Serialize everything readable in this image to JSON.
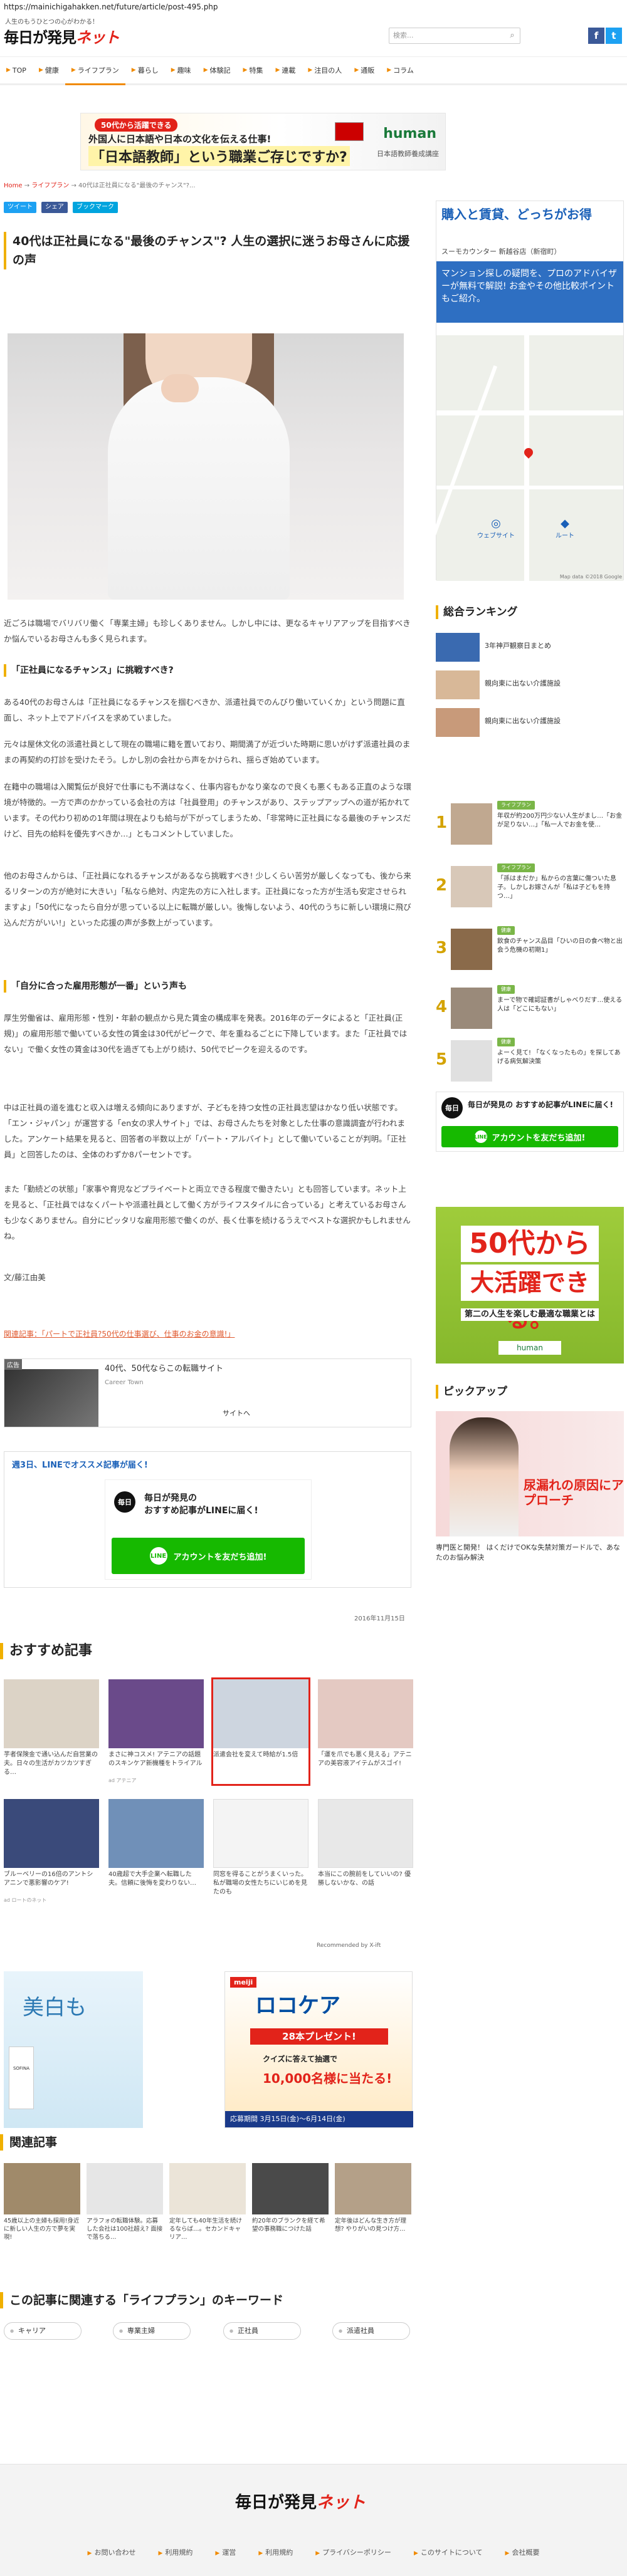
{
  "browser": {
    "url": "https://mainichigahakken.net/future/article/post-495.php"
  },
  "header": {
    "tagline": "人生のもうひとつの心がわかる！",
    "logo_main": "毎日が発見",
    "logo_net": "ネット",
    "search_placeholder": "検索...",
    "search_icon": "search-icon",
    "social": [
      {
        "label": "f",
        "color": "#3b5998"
      },
      {
        "label": "t",
        "color": "#1da1f2"
      },
      {
        "label": "L",
        "color": "#1a60b8"
      }
    ]
  },
  "nav": {
    "items": [
      "TOP",
      "健康",
      "ライフプラン",
      "暮らし",
      "趣味",
      "体験記",
      "特集",
      "連載",
      "注目の人",
      "通販",
      "コラム"
    ],
    "active_index": 2,
    "accent": "#f08a00"
  },
  "top_ad": {
    "badge": "50代から活躍できる",
    "line1": "外国人に日本語や日本の文化を伝える仕事!",
    "line2": "「日本語教師」という職業ご存じですか?",
    "brand": "human",
    "brand_sub": "日本語教師養成講座"
  },
  "breadcrumb": {
    "home": "Home",
    "sep": " → ",
    "cat": "ライフプラン",
    "current": "40代は正社員になる\"最後のチャンス\"?..."
  },
  "share": [
    {
      "label": "ツイート",
      "color": "#1da1f2"
    },
    {
      "label": "シェア",
      "color": "#3b5998"
    },
    {
      "label": "ブックマーク",
      "color": "#00a4de"
    }
  ],
  "article": {
    "title": "40代は正社員になる\"最後のチャンス\"? 人生の選択に迷うお母さんに応援の声",
    "intro": "近ごろは職場でバリバリ働く「専業主婦」も珍しくありません。しかし中には、更なるキャリアアップを目指すべきか悩んでいるお母さんも多く見られます。",
    "sec1": "「正社員になるチャンス」に挑戦すべき?",
    "p1": "ある40代のお母さんは「正社員になるチャンスを掴むべきか、派遣社員でのんびり働いていくか」という問題に直面し、ネット上でアドバイスを求めていました。",
    "p2": "元々は屋休文化の派遣社員として現在の職場に籍を置いており、期間満了が近づいた時期に思いがけず派遣社員のままの再契約の打診を受けたそう。しかし別の会社から声をかけられ、揺らぎ始めています。",
    "p3": "在籍中の職場は入閣覧伝が良好で仕事にも不満はなく、仕事内容もかなり楽なので良くも悪くもある正直のような環境が特徴的。一方で声のかかっている会社の方は「社員登用」のチャンスがあり、ステップアップへの道が拓かれています。その代わり初めの1年間は現在よりも給与が下がってしまうため、「非常時に正社員になる最後のチャンスだけど、目先の給料を優先すべきか…」ともコメントしていました。",
    "p4": "他のお母さんからは、「正社員になれるチャンスがあるなら挑戦すべき! 少しくらい苦労が厳しくなっても、後から来るリターンの方が絶対に大きい」「私なら絶対、内定先の方に入社します。正社員になった方が生活も安定させられますよ」「50代になったら自分が思っている以上に転職が厳しい。後悔しないよう、40代のうちに新しい環境に飛び込んだ方がいい!」といった応援の声が多数上がっています。",
    "sec2": "「自分に合った雇用形態が一番」という声も",
    "p5": "厚生労働省は、雇用形態・性別・年齢の観点から見た賃金の構成率を発表。2016年のデータによると「正社員(正規)」の雇用形態で働いている女性の賃金は30代がピークで、年を重ねるごとに下降しています。また「正社員ではない」で働く女性の賃金は30代を過ぎても上がり続け、50代でピークを迎えるのです。",
    "p6": "中は正社員の道を進むと収入は増える傾向にありますが、子どもを持つ女性の正社員志望はかなり低い状態です。「エン・ジャパン」が運営する「en女の求人サイト」では、お母さんたちを対象とした仕事の意識調査が行われました。アンケート結果を見ると、回答者の半数以上が「パート・アルバイト」として働いていることが判明。「正社員」と回答したのは、全体のわずか8パーセントです。",
    "p7": "また「勤続どの状態」「家事や育児などプライベートと両立できる程度で働きたい」とも回答しています。ネット上を見ると、「正社員ではなくパートや派遣社員として働く方がライフスタイルに合っている」と考えているお母さんも少なくありません。自分にピッタリな雇用形態で働くのが、長く仕事を続けるうえでベストな選択かもしれませんね。",
    "author": "文/藤江由美",
    "related_link": "関連記事：「パートで正社員?50代の仕事選び、仕事のお金の意識!」",
    "date": "2016年11月15日"
  },
  "inline_ad": {
    "tag": "広告",
    "title": "40代、50代ならこの転職サイト",
    "source": "Career Town",
    "cta": "サイトへ"
  },
  "line_box": {
    "header": "週3日、LINEでオススメ記事が届く!",
    "icon_text": "毎日",
    "line1": "毎日が発見の",
    "line2": "おすすめ記事がLINEに届く!",
    "button": "アカウントを友だち追加!"
  },
  "recommend": {
    "title": "おすすめ記事",
    "items": [
      {
        "cap": "芋者保険金で通い込んだ自営業の夫。日々の生活がカツカツすぎる…",
        "src": "",
        "color": "#dcd3c6"
      },
      {
        "cap": "まさに神コスメ! アテニアの話題のスキンケア新機種をトライアル",
        "src": "ad アテニア",
        "color": "#6a4a8a"
      },
      {
        "cap": "派遣会社を変えて時給が1.5倍",
        "src": "",
        "color": "#cdd5df"
      },
      {
        "cap": "「運を爪でも悪く見える」アテニアの美容液アイテムがスゴイ!",
        "src": "",
        "color": "#e4c9c2"
      },
      {
        "cap": "ブルーベリーの16倍のアントシアニンで悪影響のケア!",
        "src": "ad ロートのネット",
        "color": "#3a4a7a"
      },
      {
        "cap": "40歳超で大手企業へ転職した夫。信頼に後悔を変わりない…",
        "src": "",
        "color": "#7090b8"
      },
      {
        "cap": "同窓を得ることがうまくいった。私が職場の女性たちにいじめを見たのも",
        "src": "",
        "color": "#f4f4f4"
      },
      {
        "cap": "本当にこの腕前をしていいの? 優勝しないかな、の話",
        "src": "",
        "color": "#e8e8e8"
      }
    ],
    "recommended_by": "Recommended by X-ift"
  },
  "ads_bottom": {
    "ad1_text": "美白も",
    "ad1_brand": "SOFINA",
    "ad2_brand": "meiji",
    "ad2_product": "ロコケア",
    "ad2_campaign": "28本プレゼント!",
    "ad2_quiz": "クイズに答えて抽選で",
    "ad2_amount": "10,000名様に当たる!",
    "ad2_footer": "応募期間 3月15日(金)～6月14日(金)"
  },
  "related": {
    "title": "関連記事",
    "items": [
      {
        "cap": "45歳以上の主婦も採用!身近に新しい人生の方で夢を実現!",
        "color": "#a08a6a"
      },
      {
        "cap": "アラフォの転職体験。応募した会社は100社超え? 面接で落ちる…",
        "color": "#e6e6e6"
      },
      {
        "cap": "定年しても40年生活を続けるならば…。セカンドキャリア…",
        "color": "#ebe4d8"
      },
      {
        "cap": "約20年のブランクを経て希望の事務職につけた話",
        "color": "#4a4a4a"
      },
      {
        "cap": "定年後はどんな生き方が理想? やりがいの見つけ方…",
        "color": "#b4a088"
      }
    ]
  },
  "keywords": {
    "title": "この記事に関連する「ライフプラン」のキーワード",
    "items": [
      "キャリア",
      "専業主婦",
      "正社員",
      "派遣社員"
    ]
  },
  "sidebar": {
    "ad1": {
      "headline": "購入と賃貸、どっちがお得",
      "sub": "スーモカウンター 新越谷店（新宿町）",
      "blue": "マンション探しの疑問を、プロのアドバイザーが無料で解説! お金やその他比較ポイントもご紹介。",
      "map_copy": "Map data ©2018 Google",
      "btn_web": "ウェブサイト",
      "btn_route": "ルート"
    },
    "ranking_title": "総合ランキング",
    "ranking_top": [
      {
        "text": "3年神戸観察日まとめ",
        "color": "#3a6ab0"
      },
      {
        "text": "親向東に出ない介護施設",
        "color": "#d8b898"
      },
      {
        "text": "親向東に出ない介護施設",
        "color": "#c89a7a"
      }
    ],
    "ranking": [
      {
        "num": "1",
        "cat": "ライフプラン",
        "text": "年収が約200万円少ない人生がまし…「お金が足りない…」「私一人でお金を使…",
        "color": "#c0a890"
      },
      {
        "num": "2",
        "cat": "ライフプラン",
        "text": "「孫はまだか」私からの言葉に傷ついた息子。しかしお嫁さんが「私は子どもを持つ…」",
        "color": "#d8c8b8"
      },
      {
        "num": "3",
        "cat": "健康",
        "text": "飲食のチャンス品目「ひいの日の食べ物と出会う危機の初期1」",
        "color": "#8a6a4a"
      },
      {
        "num": "4",
        "cat": "健康",
        "text": "まーで物で確認証書がしゃべりだす…使える人は「どこにもない」",
        "color": "#9a8a7a"
      },
      {
        "num": "5",
        "cat": "健康",
        "text": "よーく見て! 「なくなったもの」を探してあげる病気解決策",
        "color": "#e0e0e0"
      }
    ],
    "line_text": "毎日が発見の おすすめ記事がLINEに届く!",
    "line_button": "アカウントを友だち追加!",
    "ad2": {
      "a": "50代から",
      "b": "大活躍できる。",
      "c": "第二の人生を楽しむ最適な職業とは",
      "d": "human"
    },
    "pickup_title": "ピックアップ",
    "pickup_head": "尿漏れの原因にアプローチ",
    "pickup_caption": "専門医と開発！ はくだけでOKな失禁対策ガードルで、あなたのお悩み解決"
  },
  "footer": {
    "logo_main": "毎日が発見",
    "logo_net": "ネット",
    "links": [
      "お問い合わせ",
      "利用規約",
      "運営",
      "利用規約",
      "プライバシーポリシー",
      "このサイトについて",
      "会社概要"
    ]
  }
}
